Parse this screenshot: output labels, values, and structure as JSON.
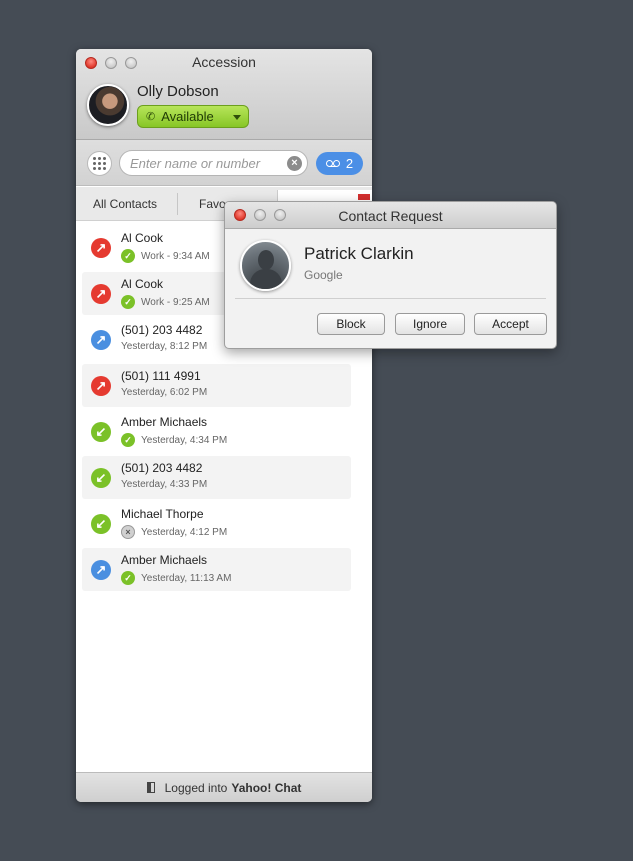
{
  "main_window": {
    "title": "Accession",
    "user": {
      "name": "Olly Dobson",
      "status": "Available"
    },
    "search": {
      "placeholder": "Enter name or number"
    },
    "voicemail": {
      "count": "2"
    },
    "tabs": [
      {
        "label": "All Contacts"
      },
      {
        "label": "Favo"
      }
    ],
    "calls": [
      {
        "name": "Al Cook",
        "detail": "Work - 9:34 AM",
        "direction": "missed",
        "dir_color": "red",
        "presence": "on",
        "highlight": false
      },
      {
        "name": "Al Cook",
        "detail": "Work - 9:25 AM",
        "direction": "missed",
        "dir_color": "red",
        "presence": "on",
        "highlight": true
      },
      {
        "name": "(501) 203 4482",
        "detail": "Yesterday, 8:12 PM",
        "direction": "outgoing",
        "dir_color": "blue",
        "presence": "none",
        "highlight": false
      },
      {
        "name": "(501) 111 4991",
        "detail": "Yesterday, 6:02 PM",
        "direction": "missed",
        "dir_color": "red",
        "presence": "none",
        "highlight": true
      },
      {
        "name": "Amber Michaels",
        "detail": "Yesterday, 4:34 PM",
        "direction": "incoming",
        "dir_color": "green",
        "presence": "on",
        "highlight": false
      },
      {
        "name": "(501) 203 4482",
        "detail": "Yesterday, 4:33 PM",
        "direction": "incoming",
        "dir_color": "green",
        "presence": "none",
        "highlight": true
      },
      {
        "name": "Michael Thorpe",
        "detail": "Yesterday, 4:12 PM",
        "direction": "incoming",
        "dir_color": "green",
        "presence": "off",
        "highlight": false
      },
      {
        "name": "Amber Michaels",
        "detail": "Yesterday, 11:13 AM",
        "direction": "outgoing",
        "dir_color": "blue",
        "presence": "on",
        "highlight": true
      }
    ],
    "footer": {
      "prefix": "Logged into",
      "service": "Yahoo! Chat"
    }
  },
  "dialog": {
    "title": "Contact Request",
    "name": "Patrick Clarkin",
    "company": "Google",
    "buttons": {
      "block": "Block",
      "ignore": "Ignore",
      "accept": "Accept"
    }
  },
  "colors": {
    "background": "#454c55",
    "missed": "#e53a30",
    "outgoing": "#4a8fe0",
    "incoming": "#7bc128",
    "voicemail_badge": "#4b8fe6",
    "available_green": "#9bd23e"
  }
}
